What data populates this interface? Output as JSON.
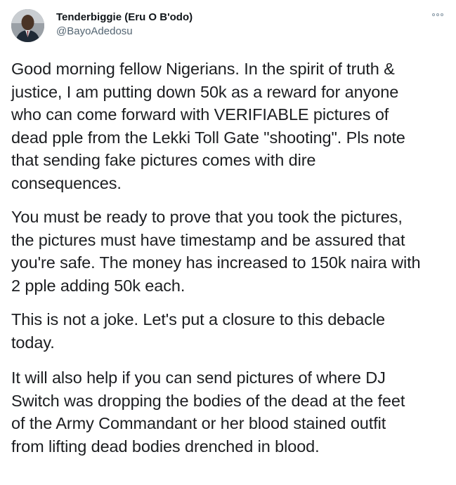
{
  "author": {
    "display_name": "Tenderbiggie (Eru O B'odo)",
    "handle": "@BayoAdedosu",
    "avatar_icon": "avatar-photo"
  },
  "menu": {
    "icon": "more-options-icon"
  },
  "tweet": {
    "paragraphs": [
      "Good morning fellow Nigerians. In the spirit of truth &\njustice, I am putting down 50k as a reward for anyone\nwho can come forward with VERIFIABLE pictures of\ndead pple from the Lekki Toll Gate \"shooting\". Pls note\nthat sending fake pictures comes with dire\nconsequences.",
      "You must be ready to prove that you took the pictures,\nthe pictures must have timestamp and be assured that\nyou're safe. The money has increased to 150k naira with\n2 pple adding 50k each.",
      "This is not a joke. Let's put a closure to this debacle\ntoday.",
      "It will also help if you can send pictures of where DJ\nSwitch was dropping the bodies of the dead at the feet\nof the Army Commandant or her blood stained outfit\nfrom lifting dead bodies drenched in blood."
    ]
  },
  "colors": {
    "name": "#0f1419",
    "handle": "#536471",
    "body_text": "#1c1e21",
    "background": "#ffffff"
  }
}
